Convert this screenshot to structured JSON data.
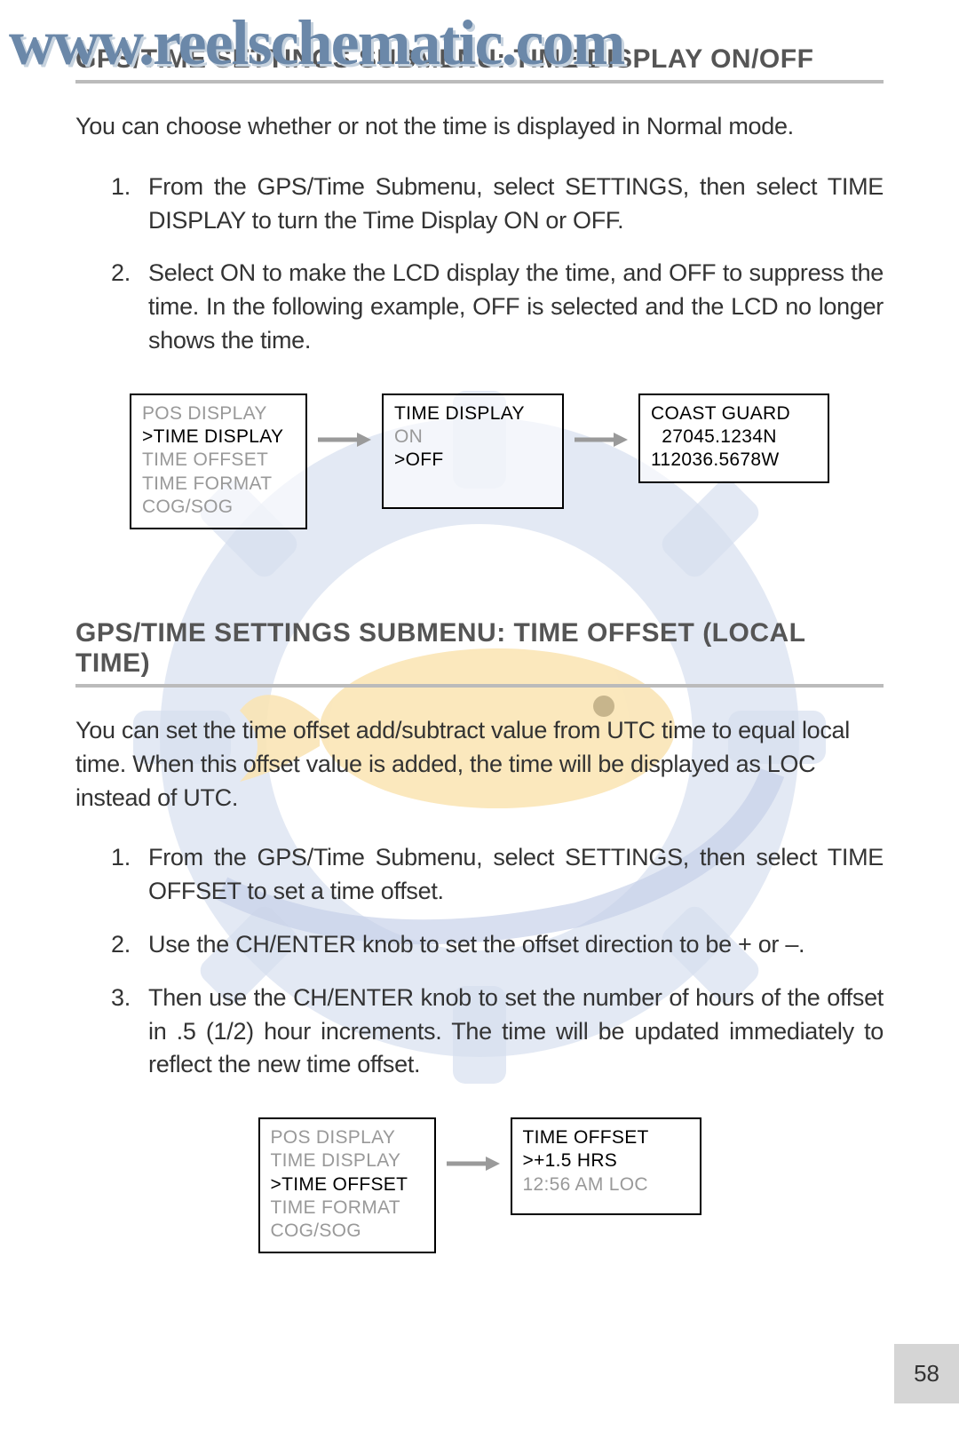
{
  "watermark_text": "www.reelschematic.com",
  "section1": {
    "heading": "GPS/TIME SETTINGS SUBMENU: TIME DISPLAY ON/OFF",
    "intro": "You can choose whether or not the time is displayed in Normal mode.",
    "steps": [
      "From the GPS/Time Submenu, select SETTINGS, then select TIME DISPLAY to turn the Time Display ON or OFF.",
      "Select ON to make the LCD display the time, and OFF to suppress the time. In the following  example, OFF is selected and the LCD no longer shows the time."
    ],
    "diagram": {
      "box1": {
        "lines": [
          {
            "text": "POS DISPLAY",
            "style": "grey"
          },
          {
            "text": ">TIME DISPLAY",
            "style": "black"
          },
          {
            "text": "TIME OFFSET",
            "style": "grey"
          },
          {
            "text": "TIME FORMAT",
            "style": "grey"
          },
          {
            "text": "COG/SOG",
            "style": "grey"
          }
        ]
      },
      "box2": {
        "lines": [
          {
            "text": "TIME DISPLAY",
            "style": "black"
          },
          {
            "text": "ON",
            "style": "grey"
          },
          {
            "text": ">OFF",
            "style": "black"
          }
        ]
      },
      "box3": {
        "lines": [
          {
            "text": "COAST GUARD",
            "style": "black"
          },
          {
            "text": "  27045.1234N",
            "style": "black"
          },
          {
            "text": "112036.5678W",
            "style": "black"
          }
        ]
      }
    }
  },
  "section2": {
    "heading": "GPS/TIME SETTINGS SUBMENU: TIME OFFSET (LOCAL TIME)",
    "intro": "You can set the time offset add/subtract value from UTC time to equal local time. When this offset value is added, the time will be displayed as LOC instead of UTC.",
    "steps": [
      "From the GPS/Time Submenu, select SETTINGS, then select TIME OFFSET to set a time offset.",
      "Use the CH/ENTER knob to set the offset direction to be + or –.",
      "Then use the CH/ENTER knob to set the number of hours of the offset in .5 (1/2) hour increments. The time will be updated immediately to reflect the new time offset."
    ],
    "diagram": {
      "box1": {
        "lines": [
          {
            "text": "POS DISPLAY",
            "style": "grey"
          },
          {
            "text": "TIME DISPLAY",
            "style": "grey"
          },
          {
            "text": ">TIME OFFSET",
            "style": "black"
          },
          {
            "text": "TIME FORMAT",
            "style": "grey"
          },
          {
            "text": "COG/SOG",
            "style": "grey"
          }
        ]
      },
      "box2": {
        "lines": [
          {
            "text": "TIME OFFSET",
            "style": "black"
          },
          {
            "text": ">+1.5 HRS",
            "style": "black"
          },
          {
            "text": "12:56 AM LOC",
            "style": "grey"
          }
        ]
      }
    }
  },
  "page_number": "58"
}
